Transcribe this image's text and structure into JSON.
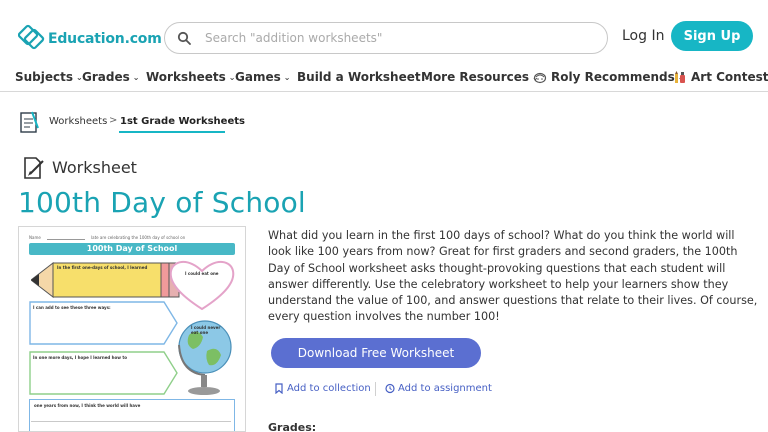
{
  "header": {
    "logo_text": "Education.com",
    "search_placeholder": "Search \"addition worksheets\"",
    "login_label": "Log In",
    "signup_label": "Sign Up"
  },
  "nav": {
    "items": [
      {
        "label": "Subjects"
      },
      {
        "label": "Grades"
      },
      {
        "label": "Worksheets"
      },
      {
        "label": "Games"
      },
      {
        "label": "Build a Worksheet"
      },
      {
        "label": "More Resources"
      },
      {
        "label": "Roly Recommends"
      },
      {
        "label": "Art Contest"
      }
    ]
  },
  "breadcrumb": {
    "item1": "Worksheets",
    "separator": ">",
    "item2": "1st Grade Worksheets"
  },
  "resource": {
    "type_label": "Worksheet",
    "title": "100th Day of School",
    "description": "What did you learn in the first 100 days of school? What do you think the world will look like 100 years from now? Great for first graders and second graders, the 100th Day of School worksheet asks thought-provoking questions that each student will answer differently. Use the celebratory worksheet to help your learners show they understand the value of 100, and answer questions that relate to their lives. Of course, every question involves the number 100!",
    "download_label": "Download Free Worksheet",
    "add_collection_label": "Add to collection",
    "add_assignment_label": "Add to assignment",
    "grades_label": "Grades:"
  },
  "thumbnail": {
    "name_label": "Name",
    "subtitle": "late are celebrating the 100th day of school on",
    "banner": "100th Day of School",
    "box1": "In the first one-days of school, I learned",
    "box2": "I could eat one",
    "box3": "I can add to see these three ways:",
    "box4": "I could never eat one",
    "box5": "In one more days, I hope I learned how to",
    "box6": "one years from now, I think the world will have"
  },
  "colors": {
    "brand_teal": "#17b6c5",
    "title_teal": "#1aa3b3",
    "download_blue": "#5b6fd1",
    "link_blue": "#4760c4"
  }
}
